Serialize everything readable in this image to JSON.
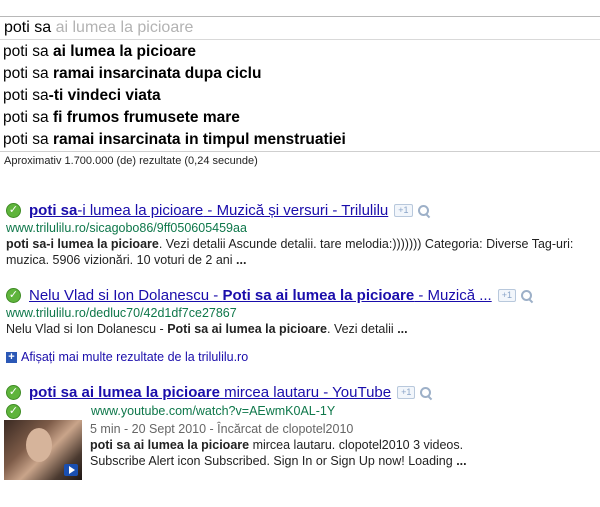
{
  "search": {
    "typed": "poti sa",
    "completion": " ai lumea la picioare"
  },
  "suggestions": [
    {
      "prefix": "poti sa ",
      "bold": "ai lumea la picioare"
    },
    {
      "prefix": "poti sa ",
      "bold": "ramai insarcinata dupa ciclu"
    },
    {
      "prefix": "poti sa",
      "bold": "-ti vindeci viata"
    },
    {
      "prefix": "poti sa ",
      "bold": "fi frumos frumusete mare"
    },
    {
      "prefix": "poti sa ",
      "bold": "ramai insarcinata in timpul menstruatiei"
    }
  ],
  "stats": "Aproximativ 1.700.000 (de) rezultate (0,24 secunde)",
  "results": [
    {
      "title_bold": "poti sa",
      "title_rest_bold": "-i lumea la picioare",
      "title_suffix": " - Muzică și versuri - Trilulilu",
      "plus_one": "+1",
      "url": "www.trilulilu.ro/sicagobo86/9ff050605459aa",
      "snippet_bold": "poti sa",
      "snippet_bold2": "-i lumea la picioare",
      "snippet_rest": ". Vezi detalii Ascunde detalii. tare melodia:))))))) Categoria: Diverse Tag-uri: muzica. 5906 vizionări. 10 voturi de 2 ani ",
      "ellipsis": "..."
    },
    {
      "title_plain": "Nelu Vlad si Ion Dolanescu - ",
      "title_bold": "Poti sa ai lumea la picioare",
      "title_suffix": " - Muzică ...",
      "plus_one": "+1",
      "url": "www.trilulilu.ro/dedluc70/42d1df7ce27867",
      "snippet_plain": "Nelu Vlad si Ion Dolanescu - ",
      "snippet_bold": "Poti sa ai lumea la picioare",
      "snippet_rest": ". Vezi detalii ",
      "ellipsis": "..."
    },
    {
      "title_bold": "poti sa ai lumea la picioare",
      "title_suffix": " mircea lautaru - YouTube",
      "plus_one": "+1",
      "url": "www.youtube.com/watch?v=AEwmK0AL-1Y",
      "meta": "5 min - 20 Sept 2010 - Încărcat de clopotel2010",
      "snippet_bold": "poti sa ai lumea la picioare",
      "snippet_rest": " mircea lautaru. clopotel2010 3 videos. Subscribe Alert icon Subscribed. Sign In or Sign Up now! Loading ",
      "ellipsis": "..."
    }
  ],
  "more_results": "Afișați mai multe rezultate de la trilulilu.ro",
  "colors": {
    "link": "#1a0dab",
    "url": "#0e774a",
    "check": "#5fb43c"
  }
}
